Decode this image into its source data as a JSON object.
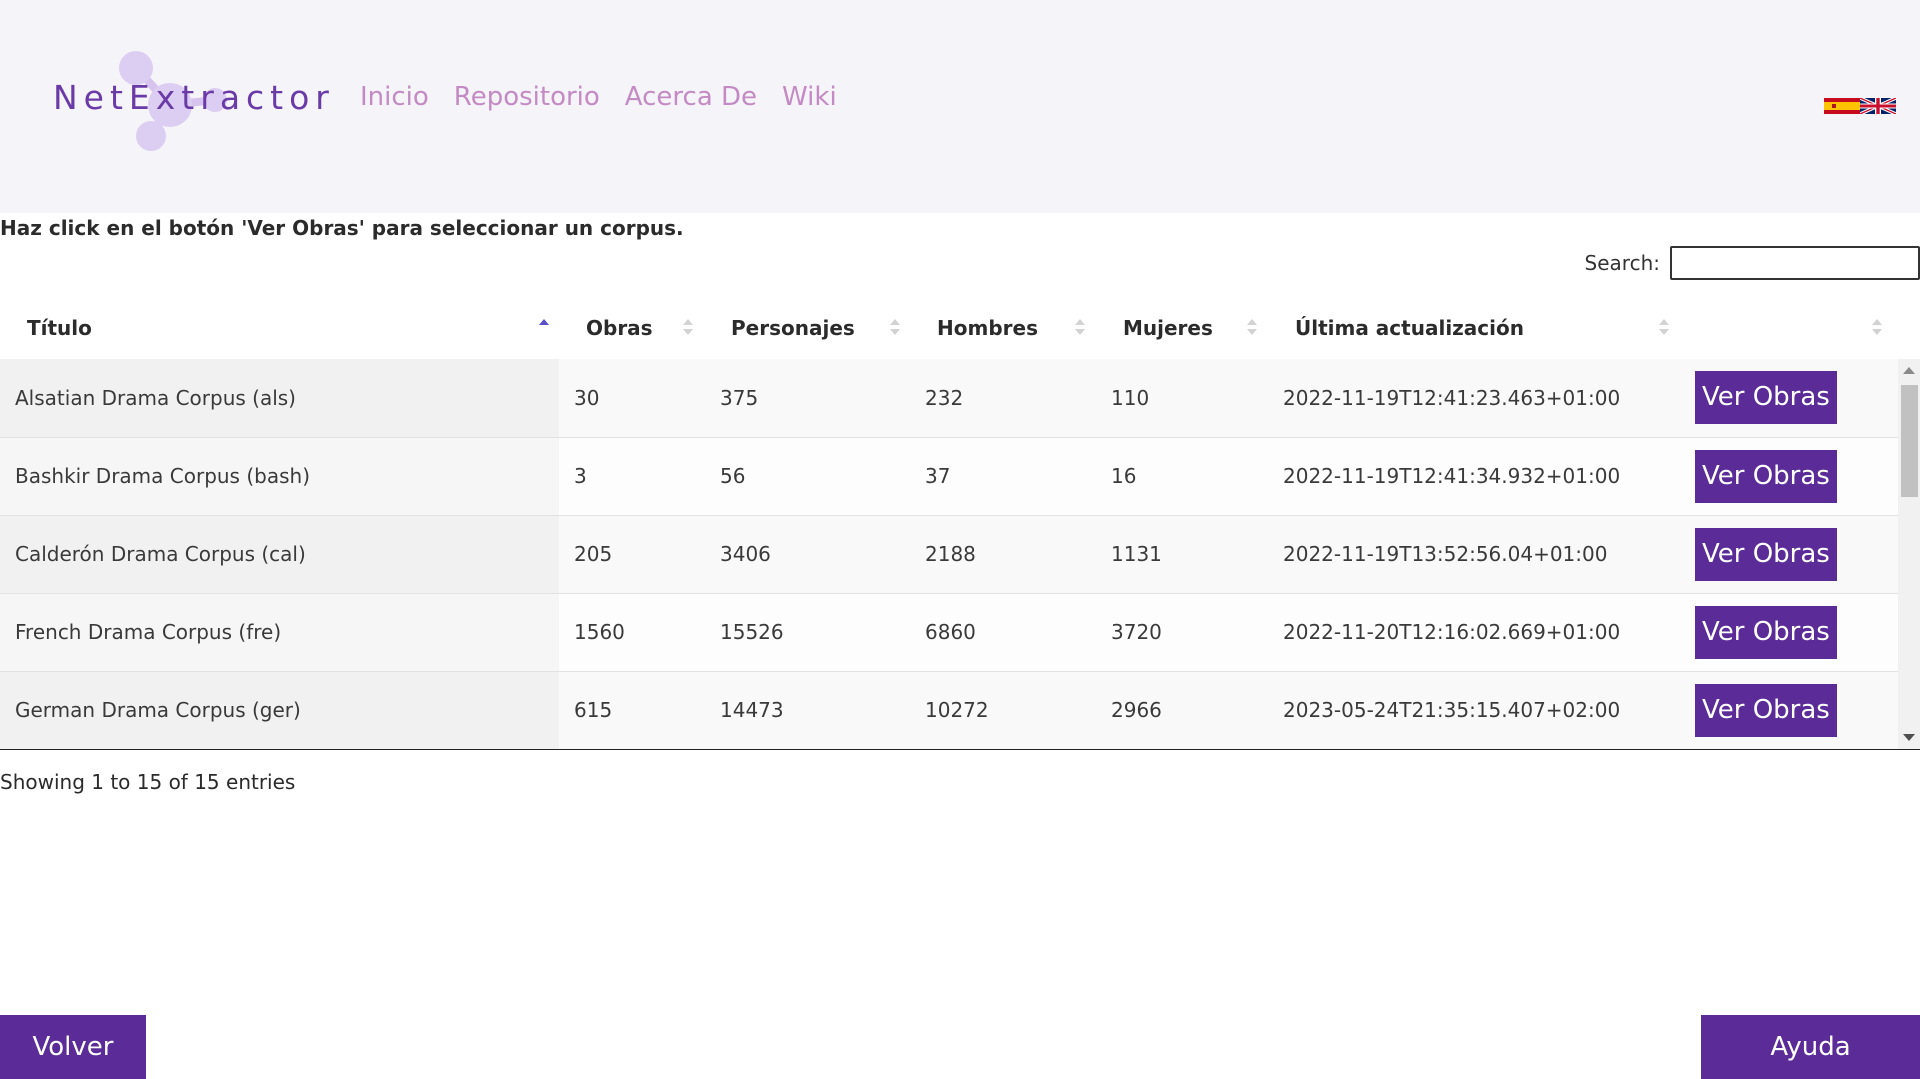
{
  "brand": {
    "name": "NetExtractor"
  },
  "nav": {
    "items": [
      {
        "label": "Inicio"
      },
      {
        "label": "Repositorio"
      },
      {
        "label": "Acerca De"
      },
      {
        "label": "Wiki"
      }
    ]
  },
  "colors": {
    "accent": "#5b2c98",
    "nav_link": "#c48ac4",
    "logo": "#6a3aa6",
    "header_bg": "#f5f4f9"
  },
  "instructions": "Haz click en el botón 'Ver Obras' para seleccionar un corpus.",
  "search": {
    "label": "Search:",
    "value": ""
  },
  "table": {
    "columns": [
      "Título",
      "Obras",
      "Personajes",
      "Hombres",
      "Mujeres",
      "Última actualización",
      ""
    ],
    "sorted_column": "Título",
    "sort_direction": "ascending",
    "rows": [
      {
        "titulo": "Alsatian Drama Corpus (als)",
        "obras": "30",
        "personajes": "375",
        "hombres": "232",
        "mujeres": "110",
        "actualizacion": "2022-11-19T12:41:23.463+01:00",
        "action": "Ver Obras"
      },
      {
        "titulo": "Bashkir Drama Corpus (bash)",
        "obras": "3",
        "personajes": "56",
        "hombres": "37",
        "mujeres": "16",
        "actualizacion": "2022-11-19T12:41:34.932+01:00",
        "action": "Ver Obras"
      },
      {
        "titulo": "Calderón Drama Corpus (cal)",
        "obras": "205",
        "personajes": "3406",
        "hombres": "2188",
        "mujeres": "1131",
        "actualizacion": "2022-11-19T13:52:56.04+01:00",
        "action": "Ver Obras"
      },
      {
        "titulo": "French Drama Corpus (fre)",
        "obras": "1560",
        "personajes": "15526",
        "hombres": "6860",
        "mujeres": "3720",
        "actualizacion": "2022-11-20T12:16:02.669+01:00",
        "action": "Ver Obras"
      },
      {
        "titulo": "German Drama Corpus (ger)",
        "obras": "615",
        "personajes": "14473",
        "hombres": "10272",
        "mujeres": "2966",
        "actualizacion": "2023-05-24T21:35:15.407+02:00",
        "action": "Ver Obras"
      }
    ]
  },
  "info": "Showing 1 to 15 of 15 entries",
  "buttons": {
    "back": "Volver",
    "help": "Ayuda"
  },
  "icons": [
    "logo-molecule-icon",
    "spain-flag-icon",
    "uk-flag-icon",
    "sort-asc-icon",
    "sort-both-icon",
    "scroll-up-icon",
    "scroll-down-icon"
  ]
}
